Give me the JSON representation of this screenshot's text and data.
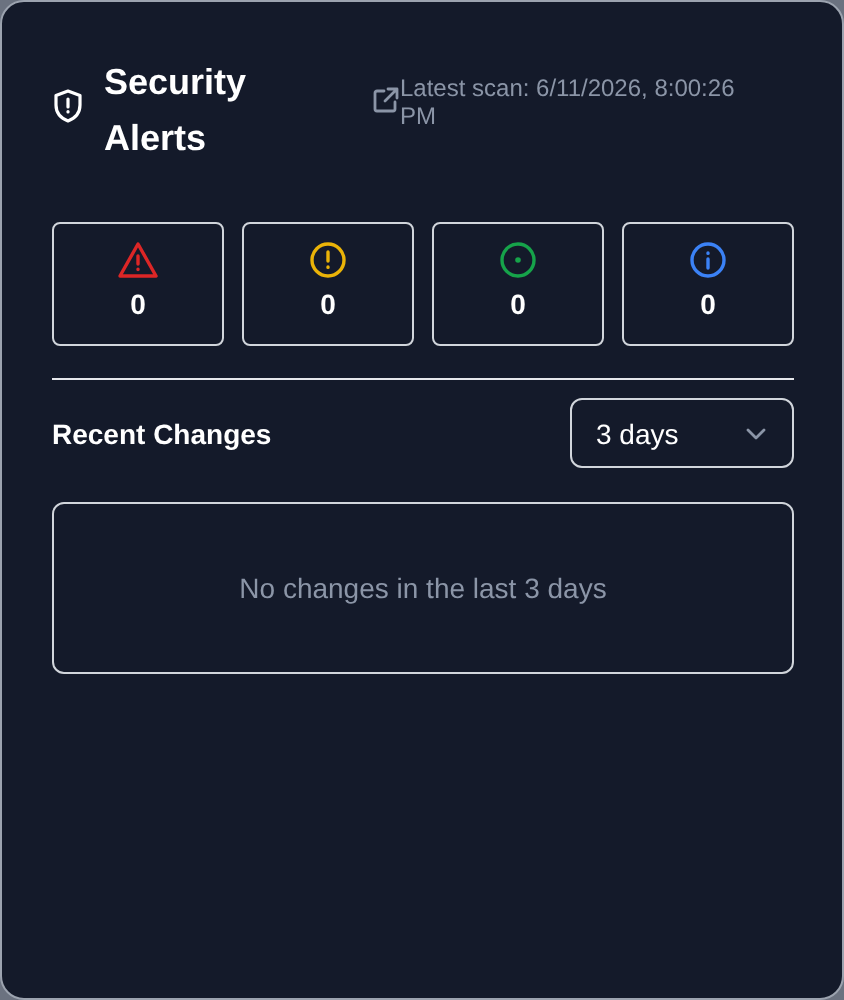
{
  "header": {
    "title": "Security Alerts",
    "scan_label": "Latest scan: 6/11/2026, 8:00:26 PM"
  },
  "severity_counts": [
    {
      "kind": "critical",
      "color": "#dc2626",
      "count": "0"
    },
    {
      "kind": "warning",
      "color": "#eab308",
      "count": "0"
    },
    {
      "kind": "ok",
      "color": "#16a34a",
      "count": "0"
    },
    {
      "kind": "info",
      "color": "#3b82f6",
      "count": "0"
    }
  ],
  "recent_changes": {
    "title": "Recent Changes",
    "range": "3 days",
    "empty_message": "No changes in the last 3 days"
  }
}
